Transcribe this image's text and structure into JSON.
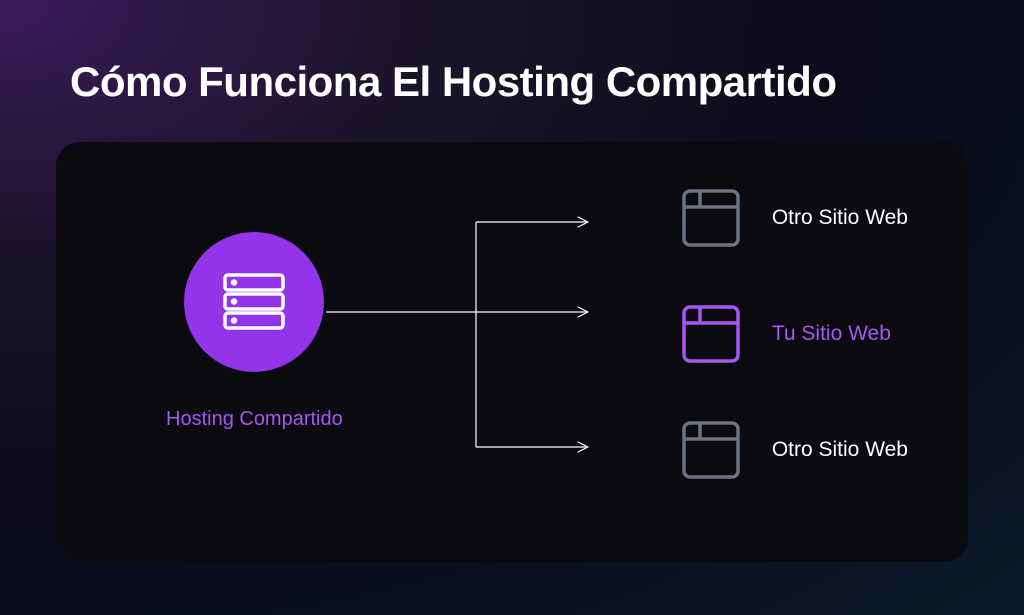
{
  "title": "Cómo Funciona El Hosting Compartido",
  "server": {
    "label": "Hosting Compartido"
  },
  "sites": {
    "other1": "Otro Sitio Web",
    "yours": "Tu Sitio Web",
    "other2": "Otro Sitio Web"
  },
  "colors": {
    "purple": "#9333ea",
    "purpleLight": "#a855f7",
    "gray": "#6b7280"
  }
}
